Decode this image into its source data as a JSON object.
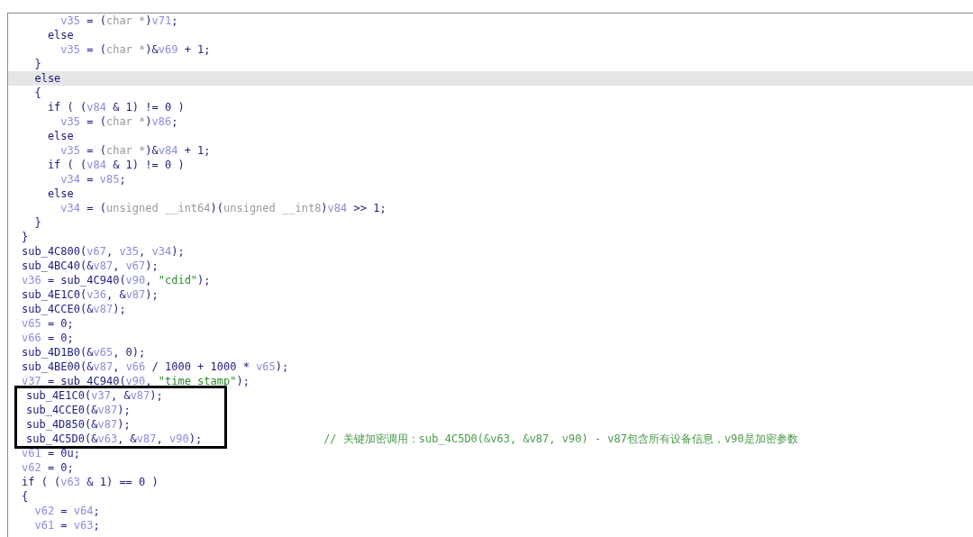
{
  "code_lines": [
    {
      "selected": false,
      "boxed": false,
      "tokens": [
        {
          "kind": "variable",
          "text": "      v35"
        },
        {
          "kind": "code",
          "text": " = ("
        },
        {
          "kind": "type",
          "text": "char *"
        },
        {
          "kind": "code",
          "text": ")"
        },
        {
          "kind": "variable",
          "text": "v71"
        },
        {
          "kind": "code",
          "text": ";"
        }
      ]
    },
    {
      "selected": false,
      "boxed": false,
      "tokens": [
        {
          "kind": "code",
          "text": "    else"
        }
      ]
    },
    {
      "selected": false,
      "boxed": false,
      "tokens": [
        {
          "kind": "variable",
          "text": "      v35"
        },
        {
          "kind": "code",
          "text": " = ("
        },
        {
          "kind": "type",
          "text": "char *"
        },
        {
          "kind": "code",
          "text": ")&"
        },
        {
          "kind": "variable",
          "text": "v69"
        },
        {
          "kind": "code",
          "text": " + 1;"
        }
      ]
    },
    {
      "selected": false,
      "boxed": false,
      "tokens": [
        {
          "kind": "code",
          "text": "  }"
        }
      ]
    },
    {
      "selected": true,
      "boxed": false,
      "tokens": [
        {
          "kind": "code",
          "text": "  else"
        }
      ]
    },
    {
      "selected": false,
      "boxed": false,
      "tokens": [
        {
          "kind": "code",
          "text": "  {"
        }
      ]
    },
    {
      "selected": false,
      "boxed": false,
      "tokens": [
        {
          "kind": "code",
          "text": "    if ( ("
        },
        {
          "kind": "variable",
          "text": "v84"
        },
        {
          "kind": "code",
          "text": " & 1) != 0 )"
        }
      ]
    },
    {
      "selected": false,
      "boxed": false,
      "tokens": [
        {
          "kind": "variable",
          "text": "      v35"
        },
        {
          "kind": "code",
          "text": " = ("
        },
        {
          "kind": "type",
          "text": "char *"
        },
        {
          "kind": "code",
          "text": ")"
        },
        {
          "kind": "variable",
          "text": "v86"
        },
        {
          "kind": "code",
          "text": ";"
        }
      ]
    },
    {
      "selected": false,
      "boxed": false,
      "tokens": [
        {
          "kind": "code",
          "text": "    else"
        }
      ]
    },
    {
      "selected": false,
      "boxed": false,
      "tokens": [
        {
          "kind": "variable",
          "text": "      v35"
        },
        {
          "kind": "code",
          "text": " = ("
        },
        {
          "kind": "type",
          "text": "char *"
        },
        {
          "kind": "code",
          "text": ")&"
        },
        {
          "kind": "variable",
          "text": "v84"
        },
        {
          "kind": "code",
          "text": " + 1;"
        }
      ]
    },
    {
      "selected": false,
      "boxed": false,
      "tokens": [
        {
          "kind": "code",
          "text": "    if ( ("
        },
        {
          "kind": "variable",
          "text": "v84"
        },
        {
          "kind": "code",
          "text": " & 1) != 0 )"
        }
      ]
    },
    {
      "selected": false,
      "boxed": false,
      "tokens": [
        {
          "kind": "variable",
          "text": "      v34"
        },
        {
          "kind": "code",
          "text": " = "
        },
        {
          "kind": "variable",
          "text": "v85"
        },
        {
          "kind": "code",
          "text": ";"
        }
      ]
    },
    {
      "selected": false,
      "boxed": false,
      "tokens": [
        {
          "kind": "code",
          "text": "    else"
        }
      ]
    },
    {
      "selected": false,
      "boxed": false,
      "tokens": [
        {
          "kind": "variable",
          "text": "      v34"
        },
        {
          "kind": "code",
          "text": " = ("
        },
        {
          "kind": "type",
          "text": "unsigned __int64"
        },
        {
          "kind": "code",
          "text": ")("
        },
        {
          "kind": "type",
          "text": "unsigned __int8"
        },
        {
          "kind": "code",
          "text": ")"
        },
        {
          "kind": "variable",
          "text": "v84"
        },
        {
          "kind": "code",
          "text": " >> 1;"
        }
      ]
    },
    {
      "selected": false,
      "boxed": false,
      "tokens": [
        {
          "kind": "code",
          "text": "  }"
        }
      ]
    },
    {
      "selected": false,
      "boxed": false,
      "tokens": [
        {
          "kind": "code",
          "text": "}"
        }
      ]
    },
    {
      "selected": false,
      "boxed": false,
      "tokens": [
        {
          "kind": "code",
          "text": "sub_4C800("
        },
        {
          "kind": "variable",
          "text": "v67"
        },
        {
          "kind": "code",
          "text": ", "
        },
        {
          "kind": "variable",
          "text": "v35"
        },
        {
          "kind": "code",
          "text": ", "
        },
        {
          "kind": "variable",
          "text": "v34"
        },
        {
          "kind": "code",
          "text": ");"
        }
      ]
    },
    {
      "selected": false,
      "boxed": false,
      "tokens": [
        {
          "kind": "code",
          "text": "sub_4BC40(&"
        },
        {
          "kind": "variable",
          "text": "v87"
        },
        {
          "kind": "code",
          "text": ", "
        },
        {
          "kind": "variable",
          "text": "v67"
        },
        {
          "kind": "code",
          "text": ");"
        }
      ]
    },
    {
      "selected": false,
      "boxed": false,
      "tokens": [
        {
          "kind": "variable",
          "text": "v36"
        },
        {
          "kind": "code",
          "text": " = sub_4C940("
        },
        {
          "kind": "variable",
          "text": "v90"
        },
        {
          "kind": "code",
          "text": ", "
        },
        {
          "kind": "string",
          "text": "\"cdid\""
        },
        {
          "kind": "code",
          "text": ");"
        }
      ]
    },
    {
      "selected": false,
      "boxed": false,
      "tokens": [
        {
          "kind": "code",
          "text": "sub_4E1C0("
        },
        {
          "kind": "variable",
          "text": "v36"
        },
        {
          "kind": "code",
          "text": ", &"
        },
        {
          "kind": "variable",
          "text": "v87"
        },
        {
          "kind": "code",
          "text": ");"
        }
      ]
    },
    {
      "selected": false,
      "boxed": false,
      "tokens": [
        {
          "kind": "code",
          "text": "sub_4CCE0(&"
        },
        {
          "kind": "variable",
          "text": "v87"
        },
        {
          "kind": "code",
          "text": ");"
        }
      ]
    },
    {
      "selected": false,
      "boxed": false,
      "tokens": [
        {
          "kind": "variable",
          "text": "v65"
        },
        {
          "kind": "code",
          "text": " = 0;"
        }
      ]
    },
    {
      "selected": false,
      "boxed": false,
      "tokens": [
        {
          "kind": "variable",
          "text": "v66"
        },
        {
          "kind": "code",
          "text": " = 0;"
        }
      ]
    },
    {
      "selected": false,
      "boxed": false,
      "tokens": [
        {
          "kind": "code",
          "text": "sub_4D1B0(&"
        },
        {
          "kind": "variable",
          "text": "v65"
        },
        {
          "kind": "code",
          "text": ", 0);"
        }
      ]
    },
    {
      "selected": false,
      "boxed": false,
      "tokens": [
        {
          "kind": "code",
          "text": "sub_4BE00(&"
        },
        {
          "kind": "variable",
          "text": "v87"
        },
        {
          "kind": "code",
          "text": ", "
        },
        {
          "kind": "variable",
          "text": "v66"
        },
        {
          "kind": "code",
          "text": " / 1000 + 1000 * "
        },
        {
          "kind": "variable",
          "text": "v65"
        },
        {
          "kind": "code",
          "text": ");"
        }
      ]
    },
    {
      "selected": false,
      "boxed": false,
      "tokens": [
        {
          "kind": "variable",
          "text": "v37"
        },
        {
          "kind": "code",
          "text": " = sub_4C940("
        },
        {
          "kind": "variable",
          "text": "v90"
        },
        {
          "kind": "code",
          "text": ", "
        },
        {
          "kind": "string",
          "text": "\"time stamp\""
        },
        {
          "kind": "code",
          "text": ");"
        }
      ]
    },
    {
      "selected": false,
      "boxed": true,
      "tokens": [
        {
          "kind": "code",
          "text": "sub_4E1C0("
        },
        {
          "kind": "variable",
          "text": "v37"
        },
        {
          "kind": "code",
          "text": ", &"
        },
        {
          "kind": "variable",
          "text": "v87"
        },
        {
          "kind": "code",
          "text": ");"
        }
      ]
    },
    {
      "selected": false,
      "boxed": true,
      "tokens": [
        {
          "kind": "code",
          "text": "sub_4CCE0(&"
        },
        {
          "kind": "variable",
          "text": "v87"
        },
        {
          "kind": "code",
          "text": ");"
        }
      ]
    },
    {
      "selected": false,
      "boxed": true,
      "tokens": [
        {
          "kind": "code",
          "text": "sub_4D850(&"
        },
        {
          "kind": "variable",
          "text": "v87"
        },
        {
          "kind": "code",
          "text": ");"
        }
      ]
    },
    {
      "selected": false,
      "boxed": true,
      "tokens": [
        {
          "kind": "code",
          "text": "sub_4C5D0(&"
        },
        {
          "kind": "variable",
          "text": "v63"
        },
        {
          "kind": "code",
          "text": ", &"
        },
        {
          "kind": "variable",
          "text": "v87"
        },
        {
          "kind": "code",
          "text": ", "
        },
        {
          "kind": "variable",
          "text": "v90"
        },
        {
          "kind": "code",
          "text": ");"
        }
      ],
      "comment": "// 关键加密调用：sub_4C5D0(&v63, &v87, v90) - v87包含所有设备信息，v90是加密参数"
    },
    {
      "selected": false,
      "boxed": false,
      "tokens": [
        {
          "kind": "variable",
          "text": "v61"
        },
        {
          "kind": "code",
          "text": " = 0u;"
        }
      ]
    },
    {
      "selected": false,
      "boxed": false,
      "tokens": [
        {
          "kind": "variable",
          "text": "v62"
        },
        {
          "kind": "code",
          "text": " = 0;"
        }
      ]
    },
    {
      "selected": false,
      "boxed": false,
      "tokens": [
        {
          "kind": "code",
          "text": "if ( ("
        },
        {
          "kind": "variable",
          "text": "v63"
        },
        {
          "kind": "code",
          "text": " & 1) == 0 )"
        }
      ]
    },
    {
      "selected": false,
      "boxed": false,
      "tokens": [
        {
          "kind": "code",
          "text": "{"
        }
      ]
    },
    {
      "selected": false,
      "boxed": false,
      "tokens": [
        {
          "kind": "variable",
          "text": "  v62"
        },
        {
          "kind": "code",
          "text": " = "
        },
        {
          "kind": "variable",
          "text": "v64"
        },
        {
          "kind": "code",
          "text": ";"
        }
      ]
    },
    {
      "selected": false,
      "boxed": false,
      "tokens": [
        {
          "kind": "variable",
          "text": "  v61"
        },
        {
          "kind": "code",
          "text": " = "
        },
        {
          "kind": "variable",
          "text": "v63"
        },
        {
          "kind": "code",
          "text": ";"
        }
      ]
    }
  ]
}
